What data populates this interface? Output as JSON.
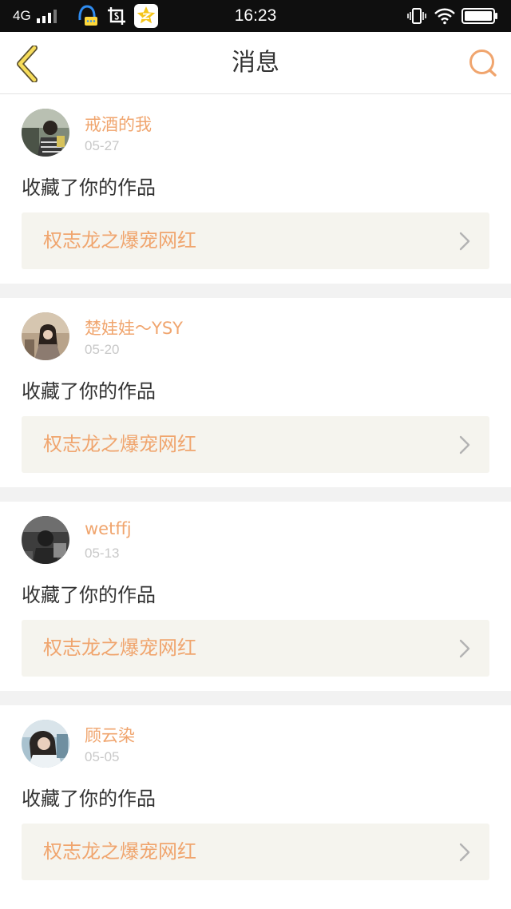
{
  "status_bar": {
    "network": "4G",
    "time": "16:23"
  },
  "nav": {
    "title": "消息",
    "back_icon": "chevron-left-icon",
    "search_icon": "search-icon"
  },
  "colors": {
    "accent": "#f0a56e",
    "back_arrow": "#f6dc5a",
    "date": "#c8c8c8",
    "card_link_bg": "#f5f4ee",
    "divider": "#f2f2f2"
  },
  "messages": [
    {
      "user": "戒酒的我",
      "date": "05-27",
      "action": "收藏了你的作品",
      "work_title": "权志龙之爆宠网红"
    },
    {
      "user": "楚娃娃～YSY",
      "date": "05-20",
      "action": "收藏了你的作品",
      "work_title": "权志龙之爆宠网红"
    },
    {
      "user": "wetffj",
      "date": "05-13",
      "action": "收藏了你的作品",
      "work_title": "权志龙之爆宠网红"
    },
    {
      "user": "顾云染",
      "date": "05-05",
      "action": "收藏了你的作品",
      "work_title": "权志龙之爆宠网红"
    }
  ]
}
